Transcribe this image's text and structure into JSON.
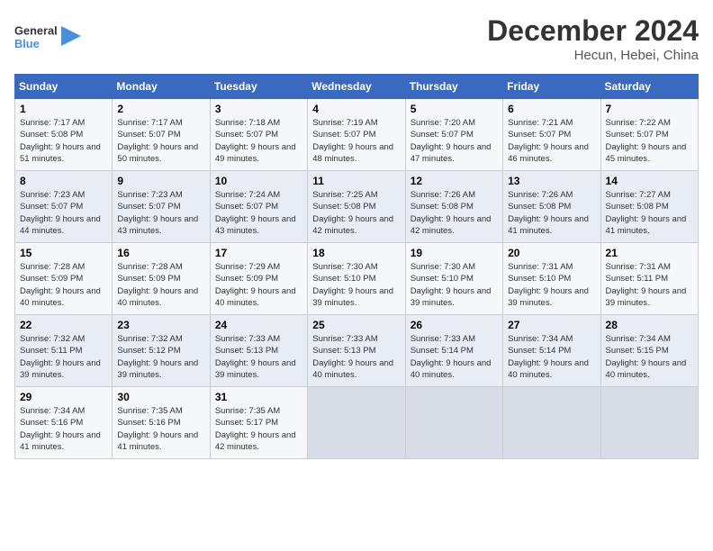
{
  "logo": {
    "line1": "General",
    "line2": "Blue"
  },
  "title": "December 2024",
  "location": "Hecun, Hebei, China",
  "weekdays": [
    "Sunday",
    "Monday",
    "Tuesday",
    "Wednesday",
    "Thursday",
    "Friday",
    "Saturday"
  ],
  "weeks": [
    [
      {
        "day": "1",
        "sunrise": "7:17 AM",
        "sunset": "5:08 PM",
        "daylight": "9 hours and 51 minutes."
      },
      {
        "day": "2",
        "sunrise": "7:17 AM",
        "sunset": "5:07 PM",
        "daylight": "9 hours and 50 minutes."
      },
      {
        "day": "3",
        "sunrise": "7:18 AM",
        "sunset": "5:07 PM",
        "daylight": "9 hours and 49 minutes."
      },
      {
        "day": "4",
        "sunrise": "7:19 AM",
        "sunset": "5:07 PM",
        "daylight": "9 hours and 48 minutes."
      },
      {
        "day": "5",
        "sunrise": "7:20 AM",
        "sunset": "5:07 PM",
        "daylight": "9 hours and 47 minutes."
      },
      {
        "day": "6",
        "sunrise": "7:21 AM",
        "sunset": "5:07 PM",
        "daylight": "9 hours and 46 minutes."
      },
      {
        "day": "7",
        "sunrise": "7:22 AM",
        "sunset": "5:07 PM",
        "daylight": "9 hours and 45 minutes."
      }
    ],
    [
      {
        "day": "8",
        "sunrise": "7:23 AM",
        "sunset": "5:07 PM",
        "daylight": "9 hours and 44 minutes."
      },
      {
        "day": "9",
        "sunrise": "7:23 AM",
        "sunset": "5:07 PM",
        "daylight": "9 hours and 43 minutes."
      },
      {
        "day": "10",
        "sunrise": "7:24 AM",
        "sunset": "5:07 PM",
        "daylight": "9 hours and 43 minutes."
      },
      {
        "day": "11",
        "sunrise": "7:25 AM",
        "sunset": "5:08 PM",
        "daylight": "9 hours and 42 minutes."
      },
      {
        "day": "12",
        "sunrise": "7:26 AM",
        "sunset": "5:08 PM",
        "daylight": "9 hours and 42 minutes."
      },
      {
        "day": "13",
        "sunrise": "7:26 AM",
        "sunset": "5:08 PM",
        "daylight": "9 hours and 41 minutes."
      },
      {
        "day": "14",
        "sunrise": "7:27 AM",
        "sunset": "5:08 PM",
        "daylight": "9 hours and 41 minutes."
      }
    ],
    [
      {
        "day": "15",
        "sunrise": "7:28 AM",
        "sunset": "5:09 PM",
        "daylight": "9 hours and 40 minutes."
      },
      {
        "day": "16",
        "sunrise": "7:28 AM",
        "sunset": "5:09 PM",
        "daylight": "9 hours and 40 minutes."
      },
      {
        "day": "17",
        "sunrise": "7:29 AM",
        "sunset": "5:09 PM",
        "daylight": "9 hours and 40 minutes."
      },
      {
        "day": "18",
        "sunrise": "7:30 AM",
        "sunset": "5:10 PM",
        "daylight": "9 hours and 39 minutes."
      },
      {
        "day": "19",
        "sunrise": "7:30 AM",
        "sunset": "5:10 PM",
        "daylight": "9 hours and 39 minutes."
      },
      {
        "day": "20",
        "sunrise": "7:31 AM",
        "sunset": "5:10 PM",
        "daylight": "9 hours and 39 minutes."
      },
      {
        "day": "21",
        "sunrise": "7:31 AM",
        "sunset": "5:11 PM",
        "daylight": "9 hours and 39 minutes."
      }
    ],
    [
      {
        "day": "22",
        "sunrise": "7:32 AM",
        "sunset": "5:11 PM",
        "daylight": "9 hours and 39 minutes."
      },
      {
        "day": "23",
        "sunrise": "7:32 AM",
        "sunset": "5:12 PM",
        "daylight": "9 hours and 39 minutes."
      },
      {
        "day": "24",
        "sunrise": "7:33 AM",
        "sunset": "5:13 PM",
        "daylight": "9 hours and 39 minutes."
      },
      {
        "day": "25",
        "sunrise": "7:33 AM",
        "sunset": "5:13 PM",
        "daylight": "9 hours and 40 minutes."
      },
      {
        "day": "26",
        "sunrise": "7:33 AM",
        "sunset": "5:14 PM",
        "daylight": "9 hours and 40 minutes."
      },
      {
        "day": "27",
        "sunrise": "7:34 AM",
        "sunset": "5:14 PM",
        "daylight": "9 hours and 40 minutes."
      },
      {
        "day": "28",
        "sunrise": "7:34 AM",
        "sunset": "5:15 PM",
        "daylight": "9 hours and 40 minutes."
      }
    ],
    [
      {
        "day": "29",
        "sunrise": "7:34 AM",
        "sunset": "5:16 PM",
        "daylight": "9 hours and 41 minutes."
      },
      {
        "day": "30",
        "sunrise": "7:35 AM",
        "sunset": "5:16 PM",
        "daylight": "9 hours and 41 minutes."
      },
      {
        "day": "31",
        "sunrise": "7:35 AM",
        "sunset": "5:17 PM",
        "daylight": "9 hours and 42 minutes."
      },
      null,
      null,
      null,
      null
    ]
  ],
  "labels": {
    "sunrise": "Sunrise:",
    "sunset": "Sunset:",
    "daylight": "Daylight:"
  }
}
